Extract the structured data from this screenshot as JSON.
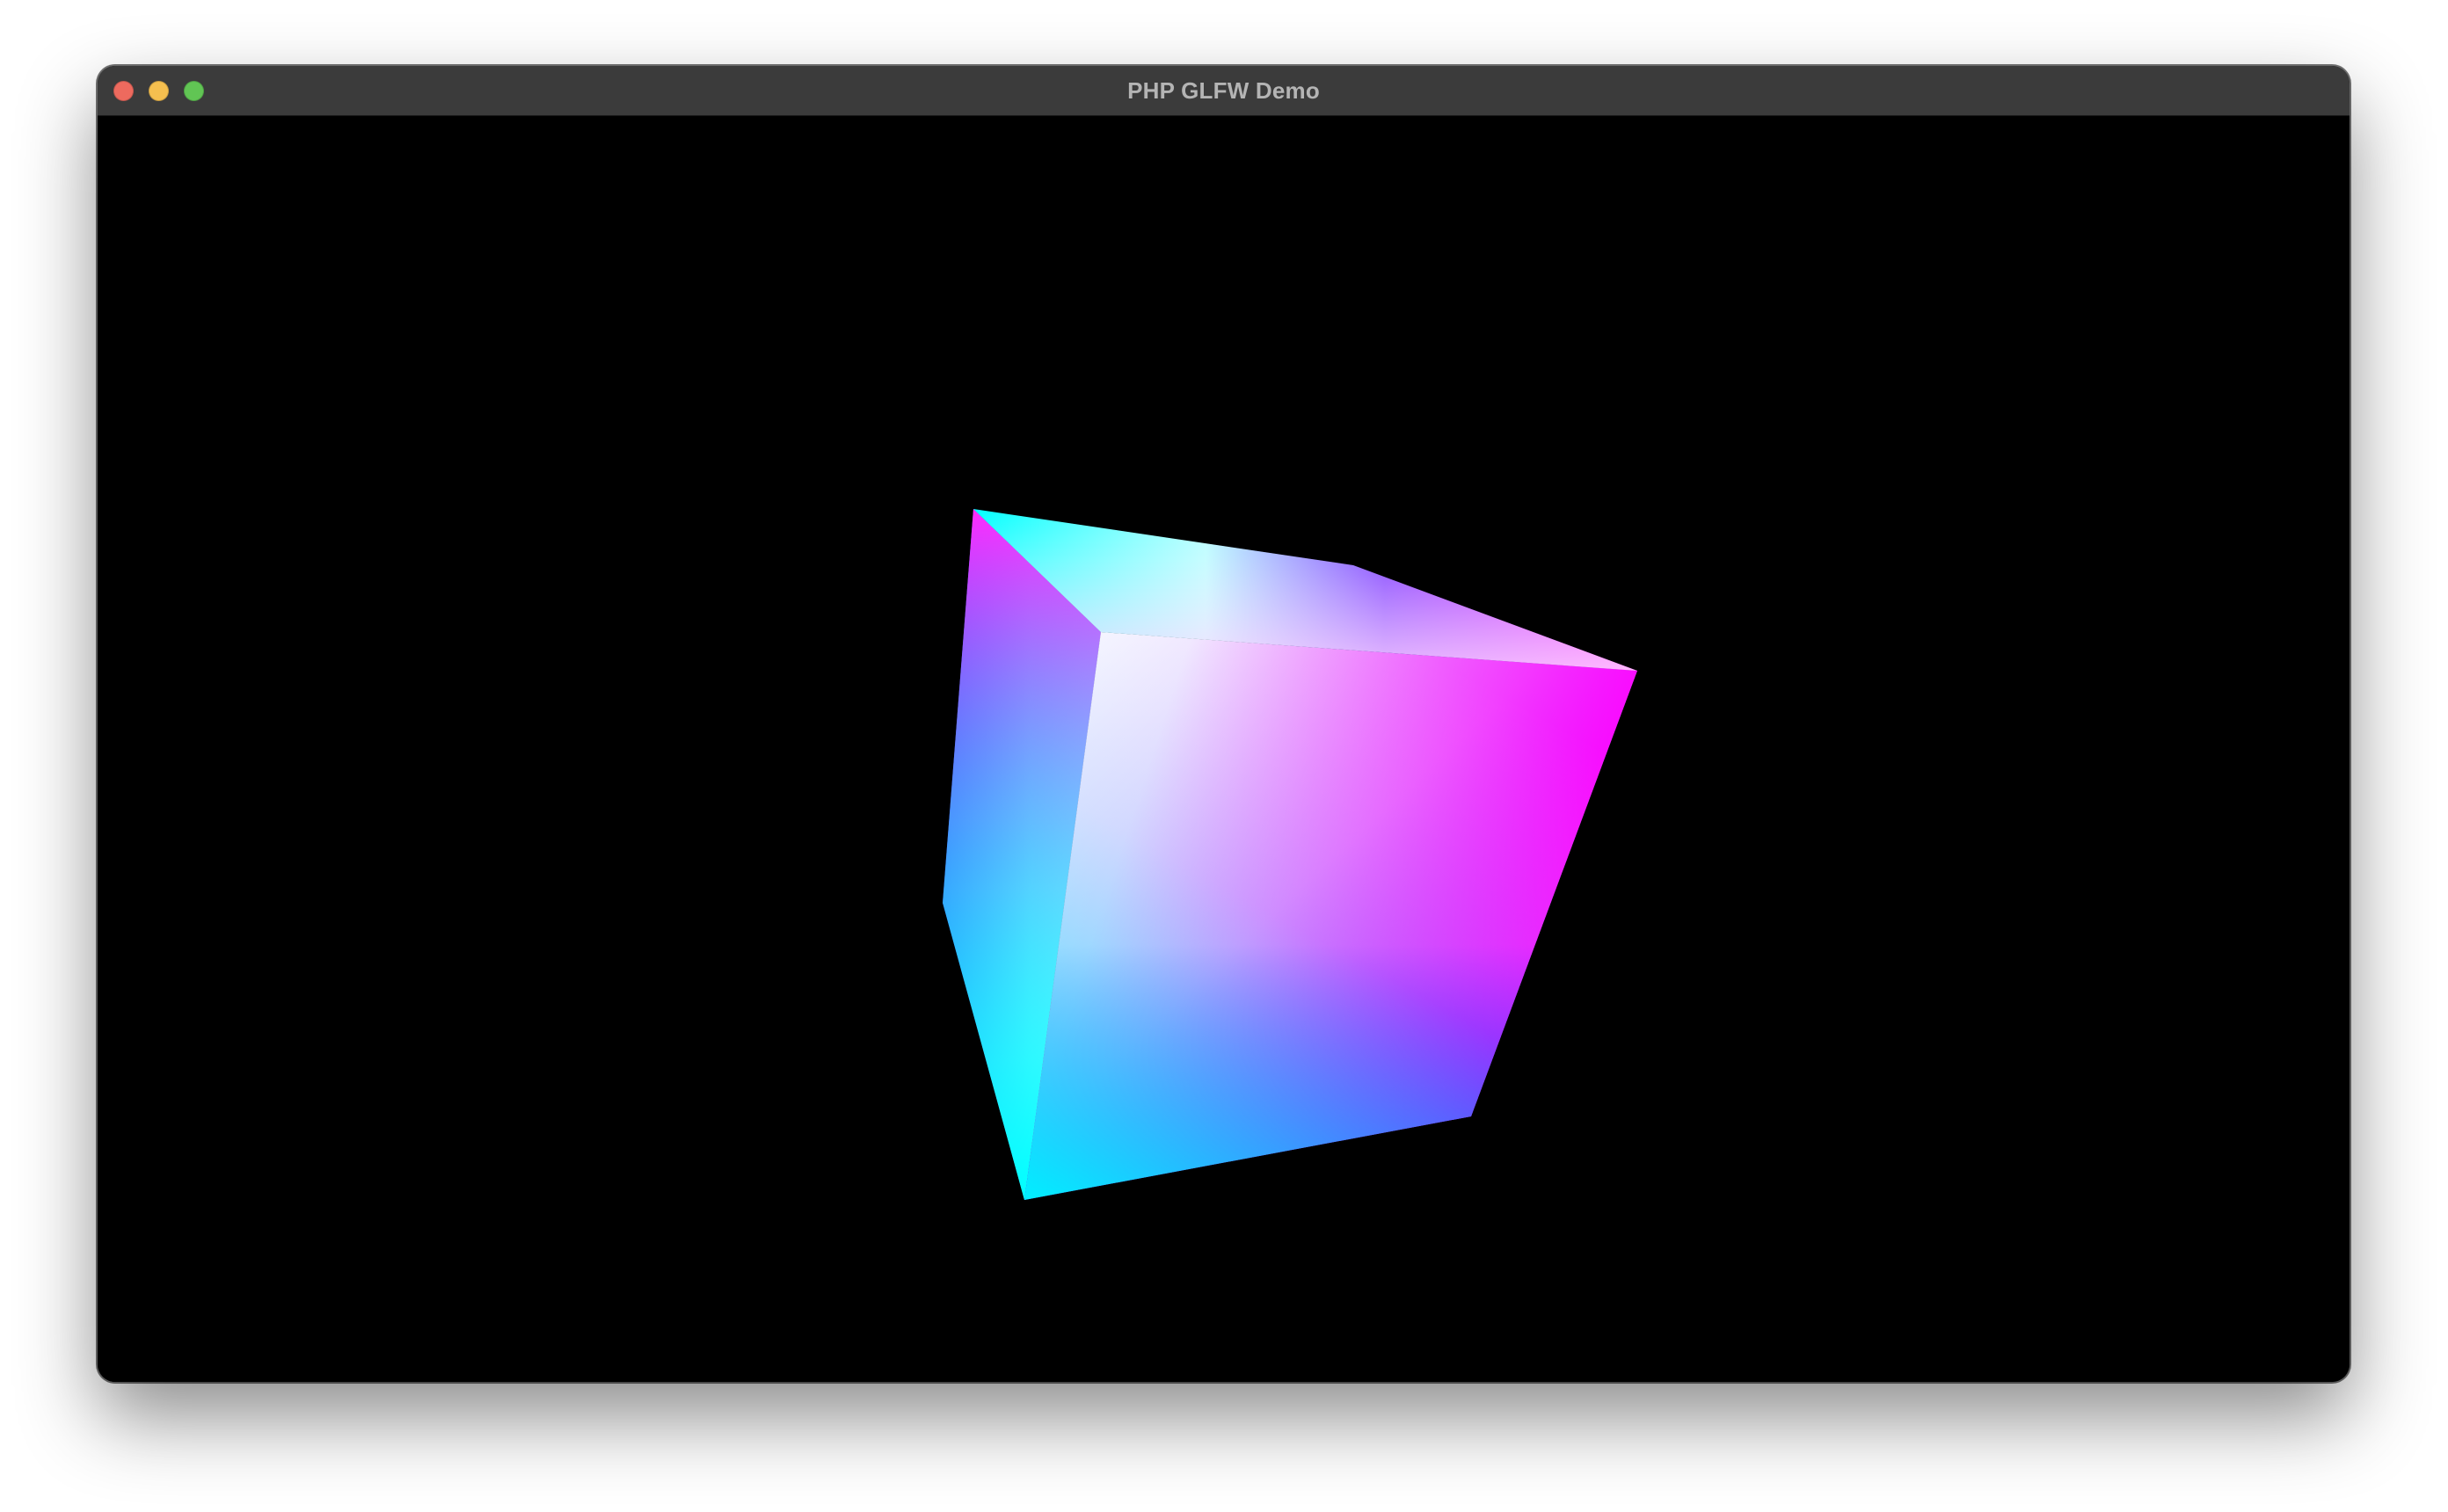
{
  "window": {
    "title": "PHP GLFW Demo"
  },
  "scene": {
    "background": "#000000",
    "object": "cube",
    "face_colors": [
      "#00ffff",
      "#ff00ff",
      "#0000ff",
      "#ffffff"
    ]
  }
}
